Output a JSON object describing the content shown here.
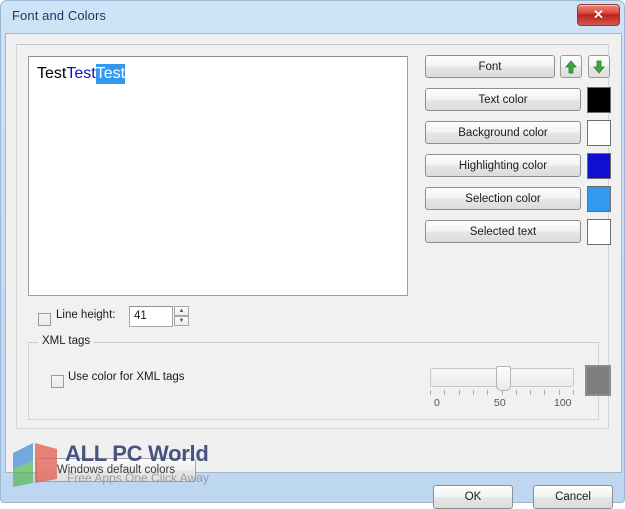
{
  "window": {
    "title": "Font and Colors",
    "close_label": "✕"
  },
  "preview": {
    "word1": "Test",
    "word2": " Test",
    "word3": "Test"
  },
  "buttons": {
    "font": "Font",
    "text_color": "Text color",
    "background_color": "Background color",
    "highlighting_color": "Highlighting color",
    "selection_color": "Selection color",
    "selected_text": "Selected text",
    "windows_default_colors": "Windows default colors",
    "ok": "OK",
    "cancel": "Cancel"
  },
  "arrows": {
    "up_icon": "arrow-up-icon",
    "down_icon": "arrow-down-icon"
  },
  "swatches": {
    "text_color": "#000000",
    "background_color": "#ffffff",
    "highlighting_color": "#0f0fd2",
    "selection_color": "#3399ee",
    "selected_text": "#ffffff",
    "xml_tags_color": "#7e7e7e"
  },
  "line_height": {
    "label": "Line height:",
    "checked": false,
    "value": "41",
    "spin_up": "▲",
    "spin_down": "▼"
  },
  "xml_tags": {
    "legend": "XML tags",
    "checkbox_label": "Use color for XML tags",
    "checked": false,
    "slider": {
      "value": 50,
      "min_label": "0",
      "mid_label": "50",
      "max_label": "100"
    }
  },
  "watermark": {
    "title": "ALL PC World",
    "subtitle": "Free Apps One Click Away"
  }
}
